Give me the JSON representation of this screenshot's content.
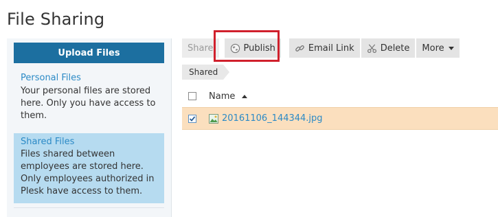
{
  "page": {
    "title": "File Sharing"
  },
  "sidebar": {
    "upload_label": "Upload Files",
    "sections": [
      {
        "link": "Personal Files",
        "desc": "Your personal files are stored here. Only you have access to them."
      },
      {
        "link": "Shared Files",
        "desc": "Files shared between employees are stored here. Only employees authorized in Plesk have access to them."
      }
    ]
  },
  "toolbar": {
    "share_label": "Share",
    "publish_label": "Publish",
    "email_link_label": "Email Link",
    "delete_label": "Delete",
    "more_label": "More"
  },
  "breadcrumb": {
    "current": "Shared"
  },
  "table": {
    "header_name": "Name",
    "rows": [
      {
        "name": "20161106_144344.jpg",
        "checked": true
      }
    ]
  },
  "colors": {
    "accent": "#1c6fa0",
    "link": "#2b8ac6",
    "selected_row": "#fbdfbe",
    "highlight": "#d0202c",
    "active_sidebar": "#b6dbf0"
  },
  "icons": {
    "publish": "globe-icon",
    "email_link": "link-icon",
    "delete": "scissors-icon",
    "file": "image-file-icon"
  }
}
